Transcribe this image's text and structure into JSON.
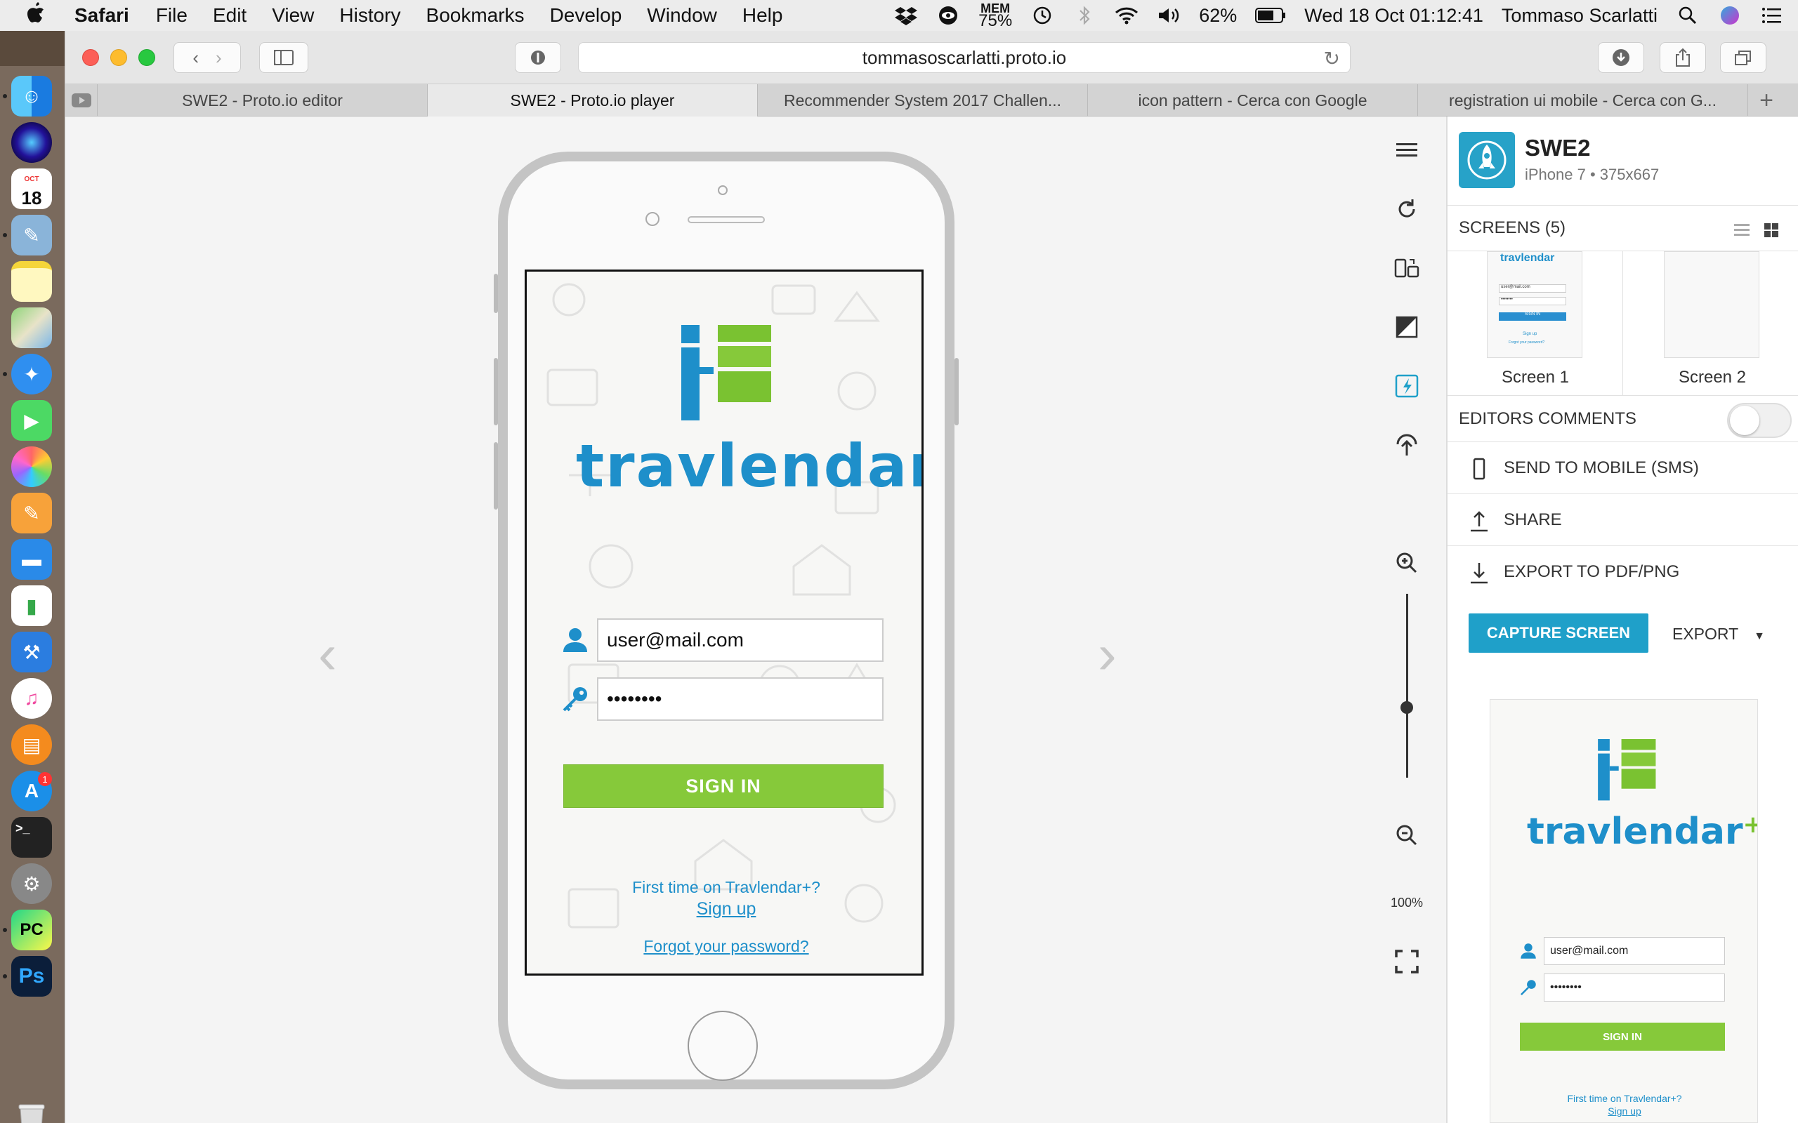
{
  "menubar": {
    "app": "Safari",
    "items": [
      "File",
      "Edit",
      "View",
      "History",
      "Bookmarks",
      "Develop",
      "Window",
      "Help"
    ],
    "mem_label": "MEM",
    "mem_value": "75%",
    "battery": "62%",
    "datetime": "Wed 18 Oct  01:12:41",
    "user": "Tommaso Scarlatti"
  },
  "dock": {
    "calendar_month": "OCT",
    "calendar_day": "18",
    "appstore_badge": "1",
    "terminal_label": ">_",
    "pycharm_label": "PC",
    "photoshop_label": "Ps"
  },
  "browser": {
    "url": "tommasoscarlatti.proto.io",
    "tabs": [
      {
        "label": "SWE2 - Proto.io editor"
      },
      {
        "label": "SWE2 - Proto.io player"
      },
      {
        "label": "Recommender System 2017 Challen..."
      },
      {
        "label": "icon pattern - Cerca con Google"
      },
      {
        "label": "registration ui mobile - Cerca con G..."
      }
    ]
  },
  "app_screen": {
    "brand": "travlendar",
    "brand_plus": "+",
    "email_value": "user@mail.com",
    "password_value": "••••••••",
    "signin_label": "SIGN IN",
    "first_time": "First time on Travlendar+?",
    "signup": "Sign up",
    "forgot": "Forgot your password?"
  },
  "tools": {
    "zoom": "100%",
    "zoom_level": 0.38
  },
  "panel": {
    "project_title": "SWE2",
    "project_sub": "iPhone 7 • 375x667",
    "screens_header": "SCREENS (5)",
    "screens": [
      {
        "label": "Screen 1"
      },
      {
        "label": "Screen 2"
      }
    ],
    "editors_comments": "EDITORS COMMENTS",
    "send_mobile": "SEND TO MOBILE (SMS)",
    "share": "SHARE",
    "export_pdf": "EXPORT TO PDF/PNG",
    "capture": "CAPTURE SCREEN",
    "export": "EXPORT"
  },
  "colors": {
    "brand_blue": "#1e8fca",
    "brand_green": "#86c93a",
    "accent": "#1fa0c9"
  }
}
